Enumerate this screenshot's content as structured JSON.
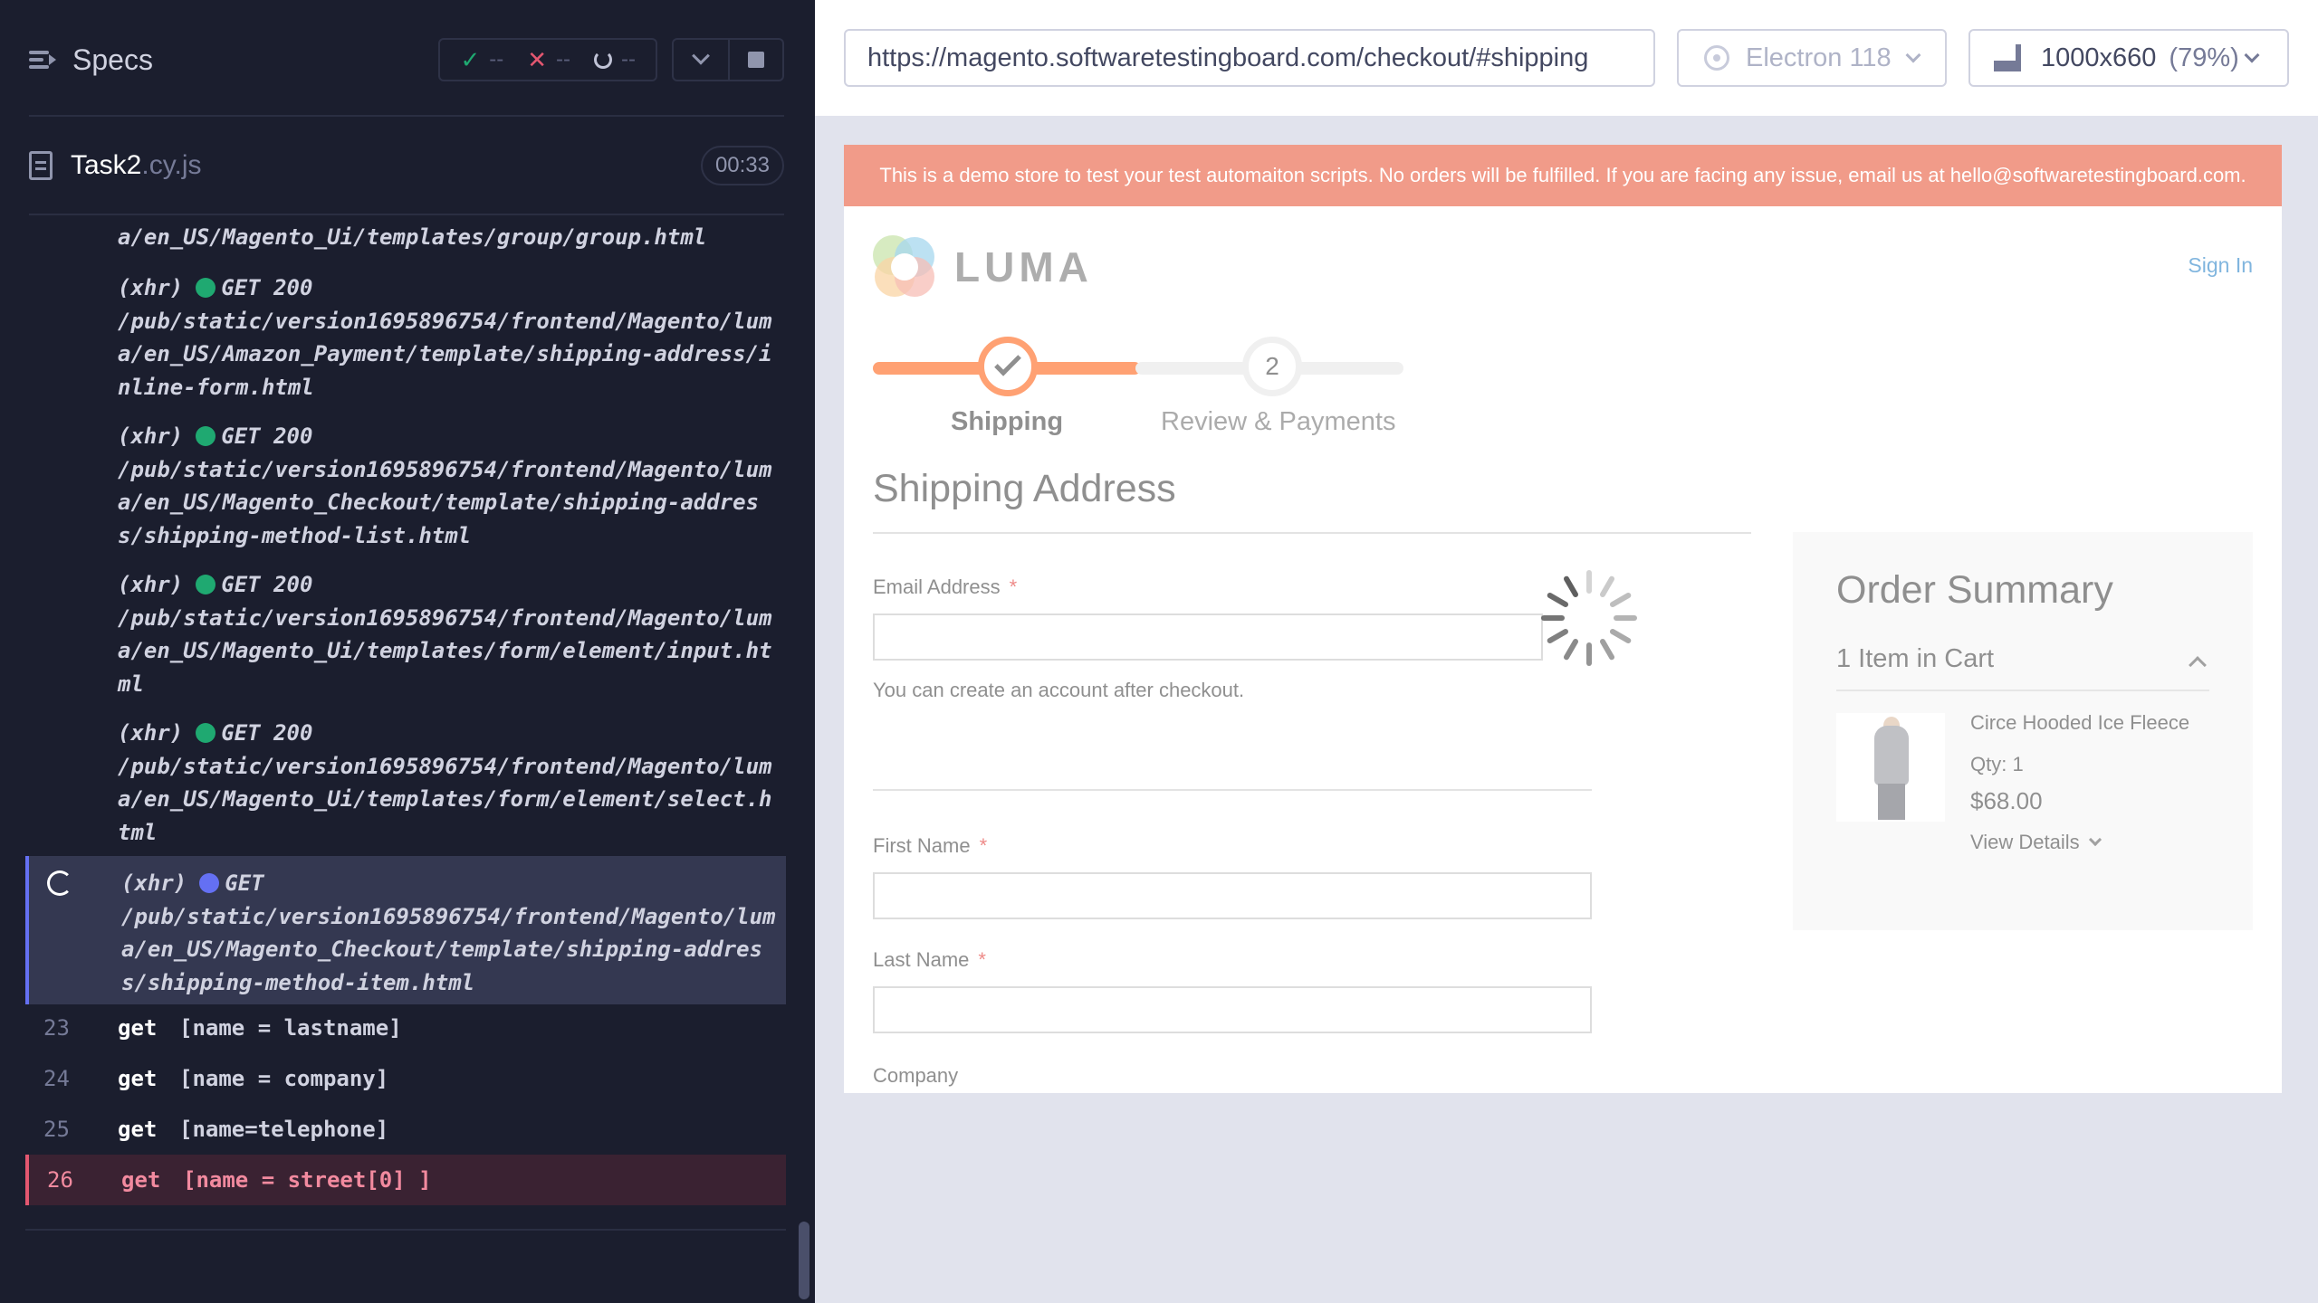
{
  "reporter": {
    "title": "Specs",
    "stats": {
      "passed": "--",
      "failed": "--",
      "pending": "--"
    },
    "spec": {
      "name": "Task2",
      "ext": ".cy.js",
      "duration": "00:33"
    },
    "log": [
      {
        "kind": "xhr",
        "prefix": "(xhr)",
        "method": "GET",
        "status": "200",
        "status_color": "#1fa971",
        "url": "a/en_US/Magento_Ui/templates/group/group.html",
        "partial": true
      },
      {
        "kind": "xhr",
        "prefix": "(xhr)",
        "method": "GET",
        "status": "200",
        "status_color": "#1fa971",
        "url": "/pub/static/version1695896754/frontend/Magento/luma/en_US/Amazon_Payment/template/shipping-address/inline-form.html"
      },
      {
        "kind": "xhr",
        "prefix": "(xhr)",
        "method": "GET",
        "status": "200",
        "status_color": "#1fa971",
        "url": "/pub/static/version1695896754/frontend/Magento/luma/en_US/Magento_Checkout/template/shipping-address/shipping-method-list.html"
      },
      {
        "kind": "xhr",
        "prefix": "(xhr)",
        "method": "GET",
        "status": "200",
        "status_color": "#1fa971",
        "url": "/pub/static/version1695896754/frontend/Magento/luma/en_US/Magento_Ui/templates/form/element/input.html"
      },
      {
        "kind": "xhr",
        "prefix": "(xhr)",
        "method": "GET",
        "status": "200",
        "status_color": "#1fa971",
        "url": "/pub/static/version1695896754/frontend/Magento/luma/en_US/Magento_Ui/templates/form/element/select.html"
      },
      {
        "kind": "xhr",
        "prefix": "(xhr)",
        "method": "GET",
        "status": "",
        "status_color": "#6470f3",
        "url": "/pub/static/version1695896754/frontend/Magento/luma/en_US/Magento_Checkout/template/shipping-address/shipping-method-item.html",
        "pending": true
      }
    ],
    "commands": [
      {
        "num": "23",
        "name": "get",
        "msg": "[name = lastname]"
      },
      {
        "num": "24",
        "name": "get",
        "msg": "[name = company]"
      },
      {
        "num": "25",
        "name": "get",
        "msg": "[name=telephone]"
      },
      {
        "num": "26",
        "name": "get",
        "msg": "[name = street[0] ]",
        "failed": true
      }
    ]
  },
  "aut": {
    "url": "https://magento.softwaretestingboard.com/checkout/#shipping",
    "browser": "Electron 118",
    "viewport": "1000x660",
    "zoom": "(79%)"
  },
  "site": {
    "banner": "This is a demo store to test your test automaiton scripts. No orders will be fulfilled. If you are facing any issue, email us at hello@softwaretestingboard.com.",
    "logo": "LUMA",
    "sign_in": "Sign In",
    "steps": [
      {
        "label": "Shipping",
        "done": true
      },
      {
        "label": "Review & Payments",
        "number": "2"
      }
    ],
    "heading": "Shipping Address",
    "fields": {
      "email": "Email Address",
      "email_note": "You can create an account after checkout.",
      "first_name": "First Name",
      "last_name": "Last Name",
      "company": "Company",
      "required_mark": "*"
    },
    "summary": {
      "title": "Order Summary",
      "cart_count": "1 Item in Cart",
      "product": {
        "name": "Circe Hooded Ice Fleece",
        "qty": "Qty: 1",
        "price": "$68.00",
        "details": "View Details"
      }
    }
  }
}
